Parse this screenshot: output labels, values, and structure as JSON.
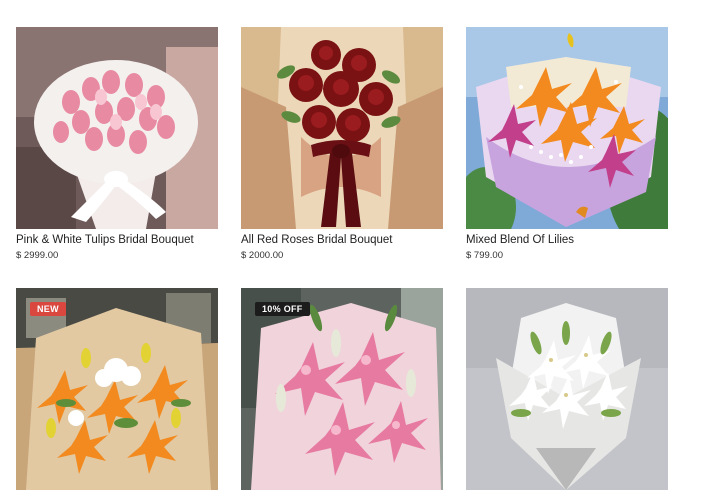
{
  "products": [
    {
      "title": "Pink & White Tulips Bridal Bouquet",
      "price": "$ 2999.00"
    },
    {
      "title": "All Red Roses Bridal Bouquet",
      "price": "$ 2000.00"
    },
    {
      "title": "Mixed Blend Of Lilies",
      "price": "$ 799.00"
    },
    {
      "badge": "NEW"
    },
    {
      "badge": "10% OFF"
    },
    {}
  ],
  "colors": {
    "badge_new": "#d9473f",
    "badge_off": "#1c1c1c"
  }
}
